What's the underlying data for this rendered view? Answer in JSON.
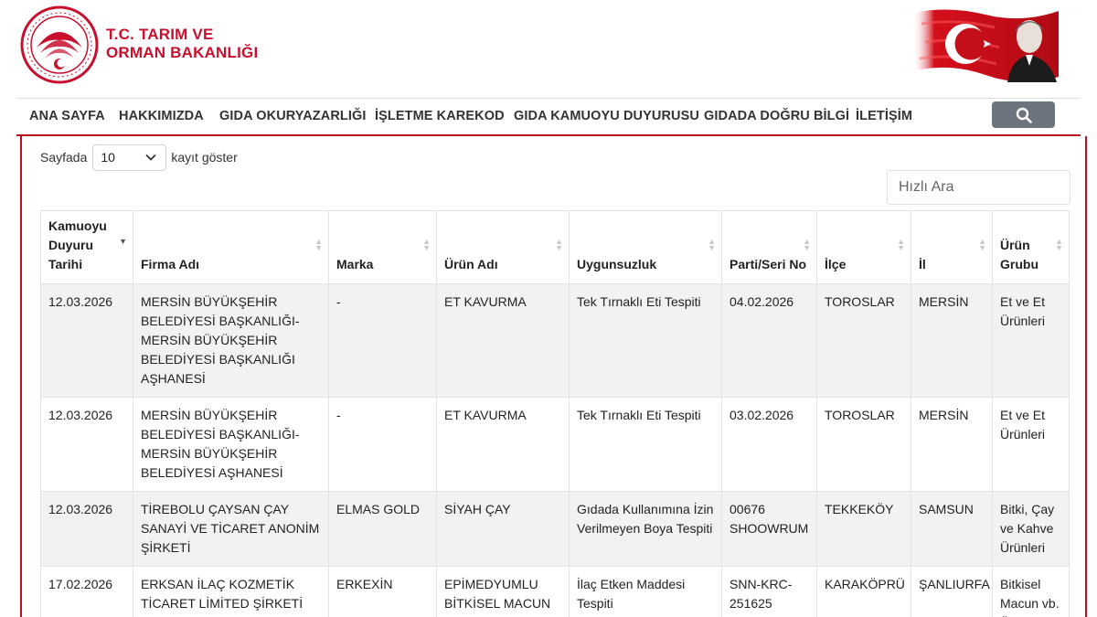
{
  "header": {
    "ministry_line1": "T.C. TARIM VE",
    "ministry_line2": "ORMAN BAKANLIĞI",
    "logo_icon": "ministry-emblem-icon",
    "banner_icon": "flag-portrait-image",
    "brand_color": "#c8102e"
  },
  "nav": {
    "items": [
      "ANA SAYFA",
      "HAKKIMIZDA",
      "GIDA OKURYAZARLIĞI",
      "İŞLETME KAREKOD",
      "GIDA KAMUOYU DUYURUSU",
      "GIDADA DOĞRU BİLGİ",
      "İLETİŞİM"
    ],
    "search_icon": "search-icon"
  },
  "table_controls": {
    "length_prefix": "Sayfada",
    "length_value": "10",
    "length_suffix": "kayıt göster",
    "quick_search_placeholder": "Hızlı Ara"
  },
  "table": {
    "columns": [
      "Kamuoyu Duyuru Tarihi",
      "Firma Adı",
      "Marka",
      "Ürün Adı",
      "Uygunsuzluk",
      "Parti/Seri No",
      "İlçe",
      "İl",
      "Ürün Grubu"
    ],
    "rows": [
      [
        "12.03.2026",
        "MERSİN BÜYÜKŞEHİR BELEDİYESİ BAŞKANLIĞI-MERSİN BÜYÜKŞEHİR BELEDİYESİ BAŞKANLIĞI AŞHANESİ",
        "-",
        "ET KAVURMA",
        "Tek Tırnaklı Eti Tespiti",
        "04.02.2026",
        "TOROSLAR",
        "MERSİN",
        "Et ve Et Ürünleri"
      ],
      [
        "12.03.2026",
        "MERSİN BÜYÜKŞEHİR BELEDİYESİ BAŞKANLIĞI-MERSİN BÜYÜKŞEHİR BELEDİYESİ AŞHANESİ",
        "-",
        "ET KAVURMA",
        "Tek Tırnaklı Eti Tespiti",
        "03.02.2026",
        "TOROSLAR",
        "MERSİN",
        "Et ve Et Ürünleri"
      ],
      [
        "12.03.2026",
        "TİREBOLU ÇAYSAN ÇAY SANAYİ VE TİCARET ANONİM ŞİRKETİ",
        "ELMAS GOLD",
        "SİYAH ÇAY",
        "Gıdada Kullanımına İzin Verilmeyen Boya Tespiti",
        "00676 SHOOWRUM",
        "TEKKEKÖY",
        "SAMSUN",
        "Bitki, Çay ve Kahve Ürünleri"
      ],
      [
        "17.02.2026",
        "ERKSAN İLAÇ KOZMETİK TİCARET LİMİTED ŞİRKETİ",
        "ERKEXİN",
        "EPİMEDYUMLU BİTKİSEL MACUN",
        "İlaç Etken Maddesi Tespiti",
        "SNN-KRC-251625",
        "KARAKÖPRÜ",
        "ŞANLIURFA",
        "Bitkisel Macun vb. Ürünler"
      ]
    ]
  }
}
